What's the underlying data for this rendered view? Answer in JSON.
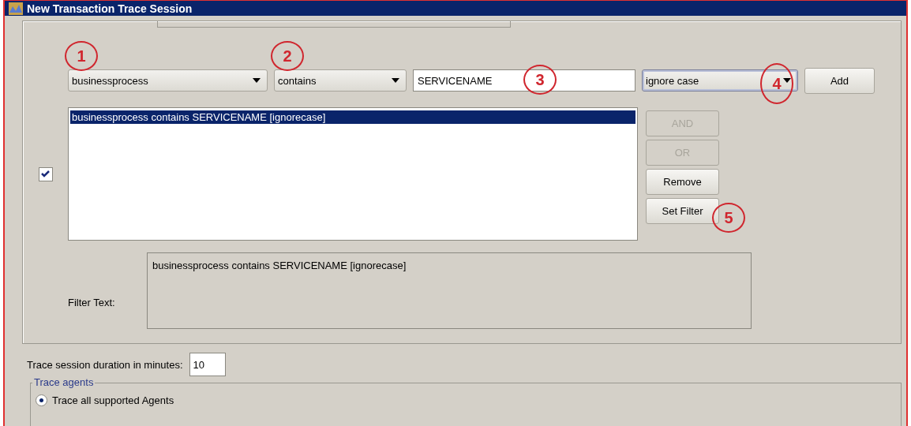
{
  "window": {
    "title": "New Transaction Trace Session"
  },
  "filter_row": {
    "field": {
      "value": "businessprocess"
    },
    "operator": {
      "value": "contains"
    },
    "text": {
      "value": "SERVICENAME"
    },
    "case": {
      "value": "ignore case",
      "focused": true
    },
    "add_button": "Add"
  },
  "filter_enabled": {
    "checked": true
  },
  "filters": [
    {
      "text": "businessprocess contains SERVICENAME [ignorecase]",
      "selected": true
    }
  ],
  "side_buttons": [
    {
      "label": "AND",
      "disabled": true
    },
    {
      "label": "OR",
      "disabled": true
    },
    {
      "label": "Remove",
      "disabled": false
    },
    {
      "label": "Set Filter",
      "disabled": false
    }
  ],
  "filter_text": {
    "label": "Filter Text:",
    "value": "businessprocess contains SERVICENAME [ignorecase]"
  },
  "duration": {
    "label": "Trace session duration in minutes:",
    "value": "10"
  },
  "trace_agents": {
    "title": "Trace agents",
    "options": [
      {
        "label": "Trace all supported Agents",
        "selected": true
      }
    ]
  },
  "annotations": [
    {
      "label": "1"
    },
    {
      "label": "2"
    },
    {
      "label": "3"
    },
    {
      "label": "4"
    },
    {
      "label": "5"
    }
  ]
}
